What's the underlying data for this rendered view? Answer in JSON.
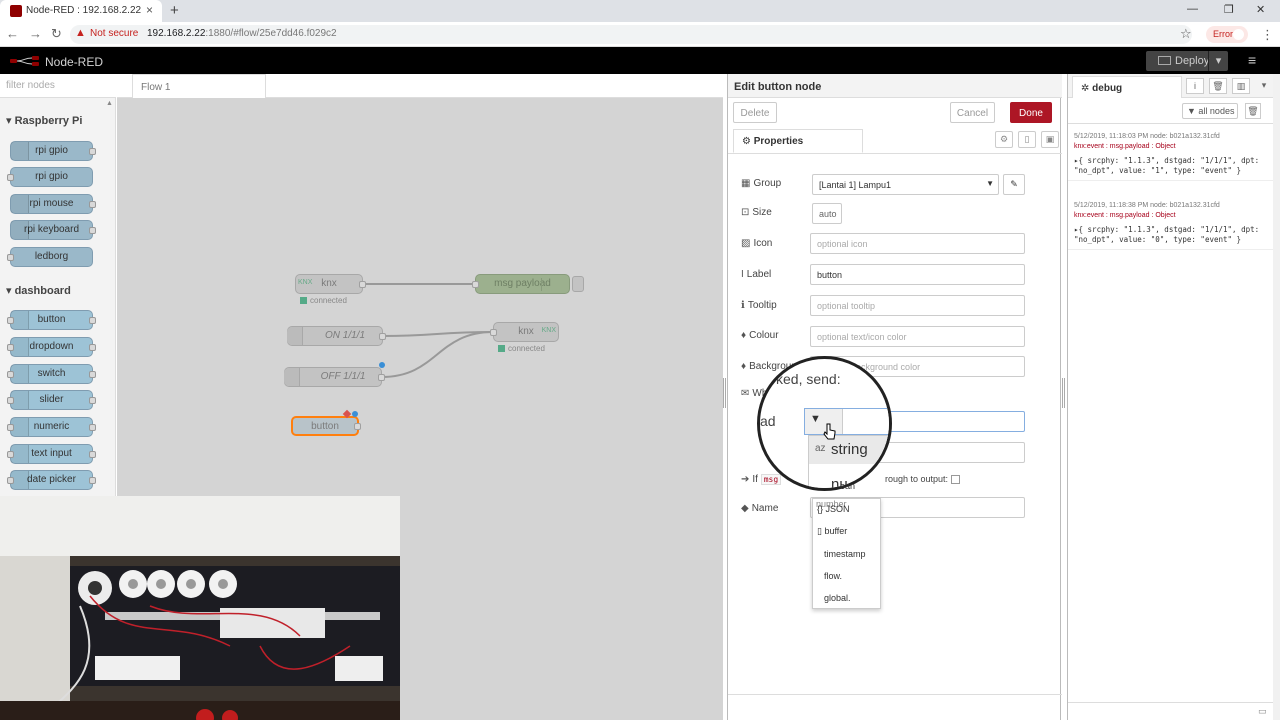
{
  "browser": {
    "tab_title": "Node-RED : 192.168.2.22",
    "close_glyph": "×",
    "newtab_glyph": "+",
    "min_glyph": "—",
    "max_glyph": "❐",
    "winclose_glyph": "✕",
    "back_glyph": "←",
    "forward_glyph": "→",
    "reload_glyph": "↻",
    "warn_glyph": "▲",
    "not_secure": "Not secure",
    "url_host": "192.168.2.22",
    "url_path": ":1880/#flow/25e7dd46.f029c2",
    "star_glyph": "☆",
    "error_badge": "Error",
    "kebab_glyph": "⋮"
  },
  "header": {
    "title": "Node-RED",
    "deploy": "Deploy",
    "deploy_caret": "▾",
    "menu_glyph": "≡"
  },
  "palette": {
    "filter_placeholder": "filter nodes",
    "categories": [
      {
        "label": "Raspberry Pi",
        "nodes": [
          "rpi gpio",
          "rpi gpio",
          "rpi mouse",
          "rpi keyboard",
          "ledborg"
        ]
      },
      {
        "label": "dashboard",
        "nodes": [
          "button",
          "dropdown",
          "switch",
          "slider",
          "numeric",
          "text input",
          "date picker"
        ]
      }
    ]
  },
  "workspace": {
    "tab": "Flow 1",
    "nodes": {
      "knx_in": "knx",
      "msg_payload": "msg payload",
      "on": "ON 1/1/1",
      "off": "OFF 1/1/1",
      "knx_out": "knx",
      "button": "button"
    },
    "status_connected": "connected",
    "knx_badge": "KNX"
  },
  "editor": {
    "title": "Edit button node",
    "delete": "Delete",
    "cancel": "Cancel",
    "done": "Done",
    "tab_properties": "Properties",
    "fields": {
      "group_label": "Group",
      "group_value": "[Lantai 1] Lampu1",
      "size_label": "Size",
      "size_value": "auto",
      "icon_label": "Icon",
      "icon_placeholder": "optional icon",
      "label_label": "Label",
      "label_value": "button",
      "tooltip_label": "Tooltip",
      "tooltip_placeholder": "optional tooltip",
      "colour_label": "Colour",
      "colour_placeholder": "optional text/icon color",
      "background_label": "Background",
      "background_placeholder": "optional background color",
      "when_label": "When clicked, send:",
      "payload_label": "Payload",
      "topic_label": "Topic",
      "passthrough_label": "If msg arrives on input, pass through to output:",
      "passthrough_prefix": "If",
      "passthrough_code": "msg",
      "passthrough_suffix": "rough to output:",
      "name_label": "Name"
    },
    "dropdown_options": [
      "string",
      "number",
      "boolean",
      "JSON",
      "buffer",
      "timestamp",
      "flow.",
      "global."
    ],
    "magnifier": {
      "heading": "ked, send:",
      "field_label": "ad",
      "option_string": "string",
      "option_partial": "nu",
      "option_partial2": "ean"
    }
  },
  "sidebar": {
    "tab": "debug",
    "filter_button": "all nodes",
    "info_glyph": "i",
    "messages": [
      {
        "meta": "5/12/2019, 11:18:03 PM   node: b021a132.31cfd",
        "topic": "knx:event : msg.payload : Object",
        "body": "▸{ srcphy: \"1.1.3\", dstgad: \"1/1/1\", dpt: \"no_dpt\", value: \"1\", type: \"event\" }"
      },
      {
        "meta": "5/12/2019, 11:18:38 PM   node: b021a132.31cfd",
        "topic": "knx:event : msg.payload : Object",
        "body": "▸{ srcphy: \"1.1.3\", dstgad: \"1/1/1\", dpt: \"no_dpt\", value: \"0\", type: \"event\" }"
      }
    ]
  },
  "colors": {
    "header": "#000000",
    "done": "#ad1625",
    "palette_node": "#9ab8c9",
    "canvas_dim": "#d4d4d4",
    "debug_topic": "#a6001a"
  }
}
